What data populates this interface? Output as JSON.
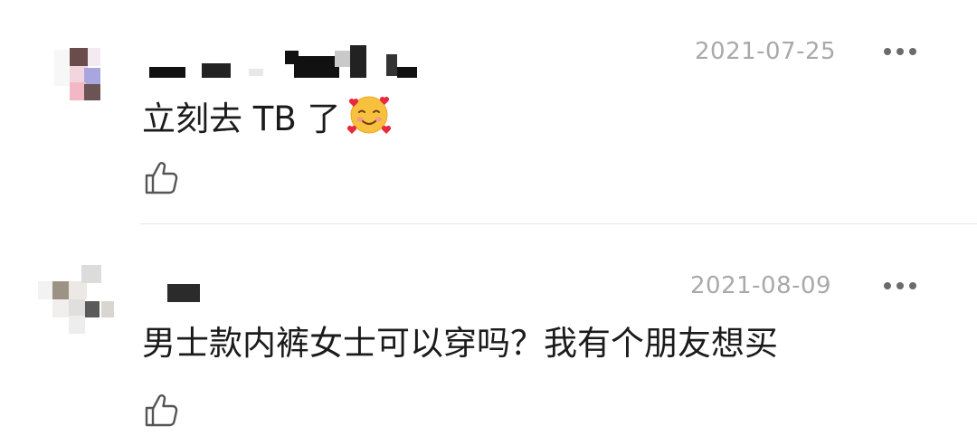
{
  "comments": [
    {
      "date": "2021-07-25",
      "text": "立刻去 TB 了",
      "emoji": "smiling-face-with-hearts-emoji",
      "like_icon": "thumbs-up-outline-icon",
      "more_icon": "more-dots-icon"
    },
    {
      "date": "2021-08-09",
      "text": "男士款内裤女士可以穿吗？我有个朋友想买",
      "like_icon": "thumbs-up-outline-icon",
      "more_icon": "more-dots-icon"
    }
  ],
  "colors": {
    "date": "#a9a9a9",
    "text": "#1b1b1b",
    "icon": "#555555",
    "divider": "#e6e6e6"
  }
}
